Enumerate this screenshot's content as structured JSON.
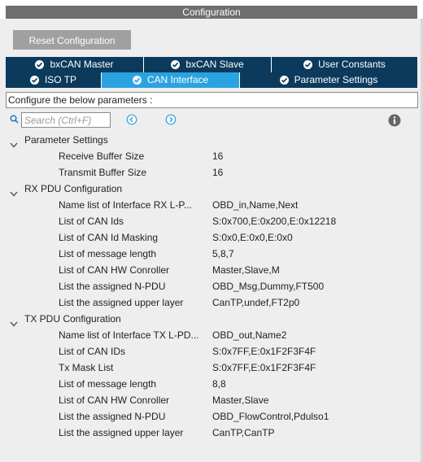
{
  "window": {
    "title": "Configuration"
  },
  "toolbar": {
    "reset_label": "Reset Configuration"
  },
  "tabs_row1": [
    {
      "label": "bxCAN Master",
      "checked": true
    },
    {
      "label": "bxCAN Slave",
      "checked": true
    },
    {
      "label": "User Constants",
      "checked": true
    }
  ],
  "tabs_row2": [
    {
      "label": "ISO TP",
      "checked": true
    },
    {
      "label": "CAN Interface",
      "checked": true,
      "active": true
    },
    {
      "label": "Parameter Settings",
      "checked": true
    }
  ],
  "colors": {
    "tab_bg": "#0b3a5c",
    "tab_active": "#2ba3e0",
    "title_bg": "#6e6e6e",
    "button_bg": "#a0a0a0"
  },
  "instructions": "Configure the below parameters :",
  "search": {
    "placeholder": "Search (Ctrl+F)"
  },
  "icons": {
    "search": "search-icon",
    "prev": "chevron-left-circle-icon",
    "next": "chevron-right-circle-icon",
    "info": "info-icon",
    "expand": "chevron-down-icon",
    "check": "check-circle-icon"
  },
  "groups": [
    {
      "label": "Parameter Settings",
      "expanded": true,
      "params": [
        {
          "name": "Receive Buffer Size",
          "value": "16"
        },
        {
          "name": "Transmit Buffer Size",
          "value": "16"
        }
      ]
    },
    {
      "label": "RX PDU Configuration",
      "expanded": true,
      "params": [
        {
          "name": "Name list of Interface RX L-P...",
          "value": "OBD_in,Name,Next"
        },
        {
          "name": "List of CAN Ids",
          "value": "S:0x700,E:0x200,E:0x12218"
        },
        {
          "name": "List of CAN Id Masking",
          "value": "S:0x0,E:0x0,E:0x0"
        },
        {
          "name": "List of message length",
          "value": "5,8,7"
        },
        {
          "name": "List of CAN HW Conroller",
          "value": "Master,Slave,M"
        },
        {
          "name": "List the assigned N-PDU",
          "value": "OBD_Msg,Dummy,FT500"
        },
        {
          "name": "List the assigned upper layer",
          "value": "CanTP,undef,FT2p0"
        }
      ]
    },
    {
      "label": "TX PDU Configuration",
      "expanded": true,
      "params": [
        {
          "name": "Name list of Interface TX L-PD...",
          "value": "OBD_out,Name2"
        },
        {
          "name": "List of CAN IDs",
          "value": "S:0x7FF,E:0x1F2F3F4F"
        },
        {
          "name": "Tx Mask List",
          "value": "S:0x7FF,E:0x1F2F3F4F"
        },
        {
          "name": "List of message length",
          "value": "8,8"
        },
        {
          "name": "List of CAN HW Conroller",
          "value": "Master,Slave"
        },
        {
          "name": "List the assigned N-PDU",
          "value": "OBD_FlowControl,Pdulso1"
        },
        {
          "name": "List the assigned upper layer",
          "value": "CanTP,CanTP"
        }
      ]
    }
  ]
}
